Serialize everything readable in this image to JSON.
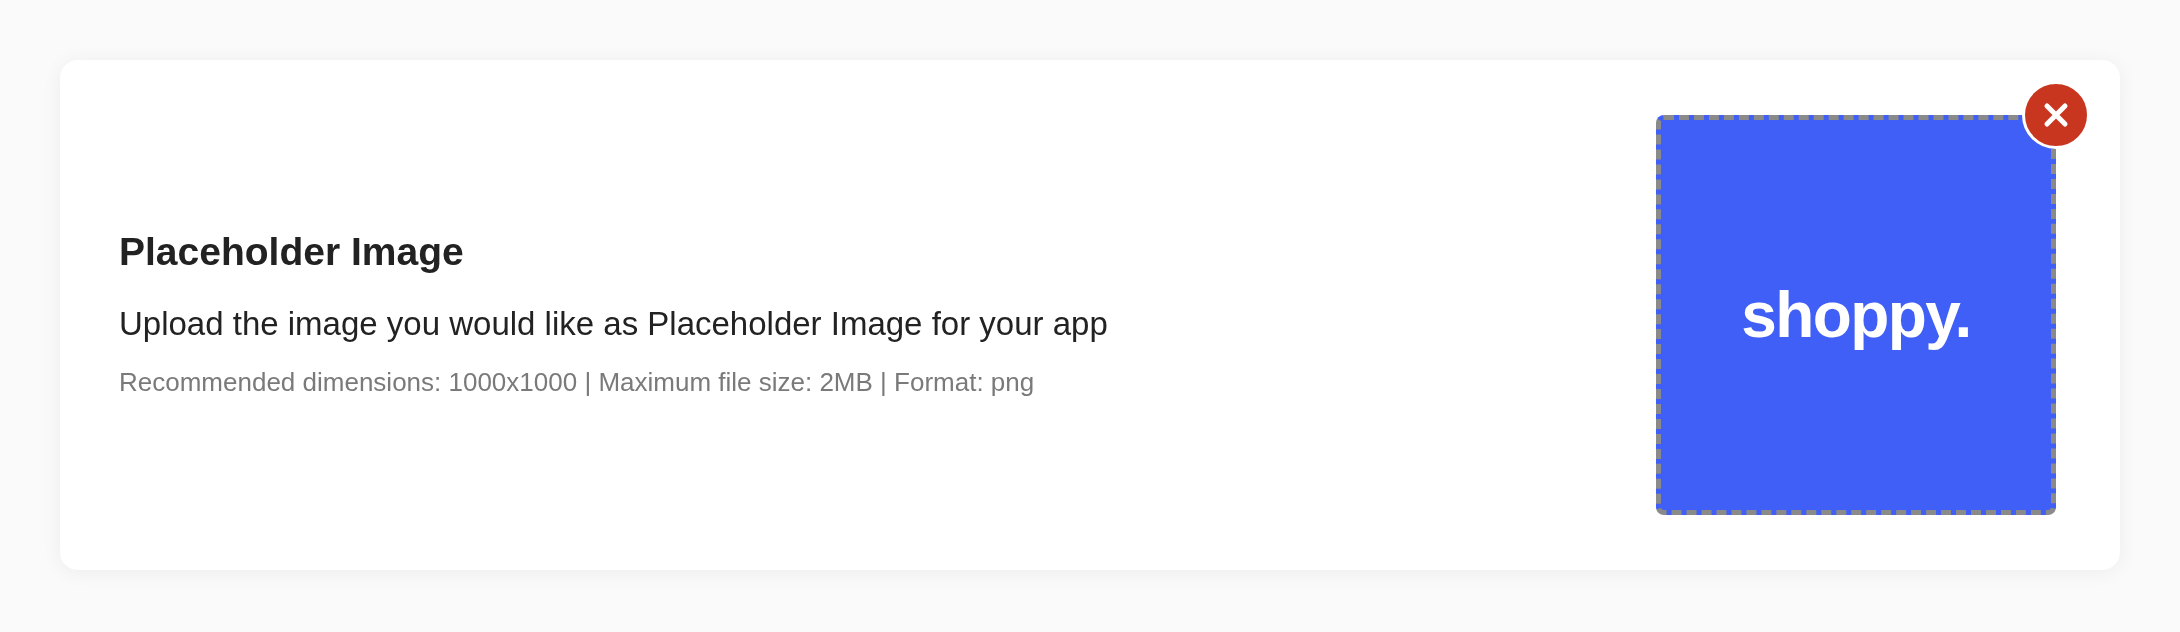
{
  "card": {
    "title": "Placeholder Image",
    "description": "Upload the image you would like as Placeholder Image for your app",
    "requirements": "Recommended dimensions: 1000x1000 | Maximum file size: 2MB | Format: png",
    "preview": {
      "text": "shoppy.",
      "color": "#3f5ff6"
    }
  }
}
